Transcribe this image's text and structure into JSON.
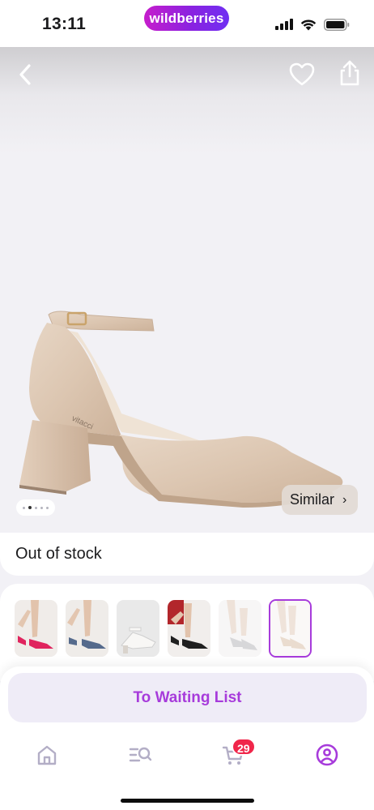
{
  "status_bar": {
    "time": "13:11",
    "brand": "wildberries",
    "icons": [
      "signal-icon",
      "wifi-icon",
      "battery-icon"
    ]
  },
  "gallery": {
    "icons": [
      "back-arrow-icon",
      "heart-icon",
      "share-icon"
    ],
    "image_count": 5,
    "active_image": 1,
    "similar_label": "Similar",
    "similar_icon": "chevron-right-icon"
  },
  "stock": {
    "label": "Out of stock"
  },
  "variants": {
    "items": [
      {
        "color": "pink",
        "selected": false
      },
      {
        "color": "blue",
        "selected": false
      },
      {
        "color": "white",
        "selected": false
      },
      {
        "color": "black",
        "selected": false
      },
      {
        "color": "light-gray",
        "selected": false
      },
      {
        "color": "beige",
        "selected": true
      }
    ]
  },
  "action": {
    "waiting_list_label": "To Waiting List"
  },
  "tabbar": {
    "items": [
      {
        "name": "home",
        "icon": "home-icon"
      },
      {
        "name": "catalog",
        "icon": "catalog-search-icon"
      },
      {
        "name": "cart",
        "icon": "cart-icon",
        "badge": "29"
      },
      {
        "name": "profile",
        "icon": "profile-icon",
        "active": true
      }
    ]
  },
  "colors": {
    "accent": "#a73bdb",
    "badge": "#f0264a",
    "brand_gradient_start": "#c61dcc",
    "brand_gradient_end": "#6f2ff2",
    "button_bg": "#efecf7"
  }
}
